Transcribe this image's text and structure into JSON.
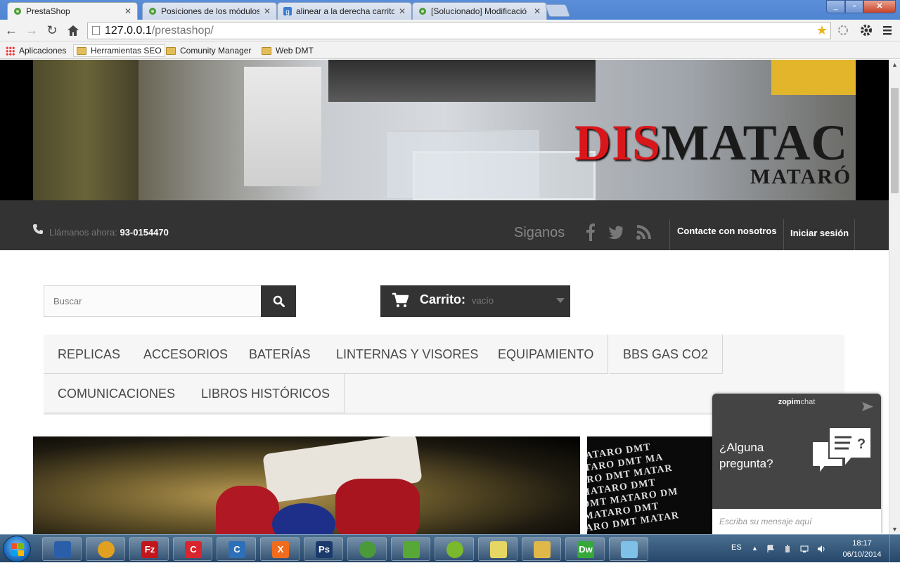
{
  "browser": {
    "tabs": [
      {
        "label": "PrestaShop",
        "active": true,
        "icon": "prestashop-icon"
      },
      {
        "label": "Posiciones de los módulos",
        "active": false,
        "icon": "prestashop-icon"
      },
      {
        "label": "alinear a la derecha carrito",
        "active": false,
        "icon": "google-icon"
      },
      {
        "label": "[Solucionado] Modificació",
        "active": false,
        "icon": "prestashop-icon"
      }
    ],
    "tab_close_glyph": "✕",
    "url_host": "127.0.0.1",
    "url_path": "/prestashop/",
    "bookmarks": [
      "Aplicaciones",
      "Herramientas SEO",
      "Comunity Manager",
      "Web DMT"
    ]
  },
  "header": {
    "brand_red": "DIS",
    "brand_dark": "MATAC",
    "brand_sub": "MATARÓ",
    "call_label": "Llámanos ahora:",
    "phone": "93-0154470",
    "follow_label": "Siganos",
    "social_icons": [
      "facebook-icon",
      "twitter-icon",
      "rss-icon"
    ],
    "contact_label": "Contacte con nosotros",
    "login_label": "Iniciar sesión"
  },
  "search": {
    "placeholder": "Buscar"
  },
  "cart": {
    "title": "Carrito:",
    "status": "vacío"
  },
  "menu": [
    "REPLICAS",
    "ACCESORIOS",
    "BATERÍAS",
    "LINTERNAS Y VISORES",
    "EQUIPAMIENTO",
    "BBS GAS CO2",
    "COMUNICACIONES",
    "LIBROS HISTÓRICOS"
  ],
  "slide_right_text": [
    "MATARO DMT",
    "ATARO DMT MA",
    "ARO DMT MATAR",
    "MATARO DMT",
    "DMT MATARO DM",
    "MATARO DMT",
    "ARO DMT MATAR"
  ],
  "chat": {
    "brand_bold": "zopim",
    "brand_light": "chat",
    "question": "¿Alguna pregunta?",
    "placeholder": "Escriba su mensaje aquí"
  },
  "taskbar": {
    "apps": [
      {
        "name": "thunderbird-icon",
        "color": "#2a5ea8",
        "glyph": ""
      },
      {
        "name": "chrome-icon",
        "color": "#e0a020",
        "glyph": ""
      },
      {
        "name": "filezilla-icon",
        "color": "#c3161c",
        "glyph": "Fz"
      },
      {
        "name": "ccleaner-red-icon",
        "color": "#d9262e",
        "glyph": "C"
      },
      {
        "name": "ccleaner-icon",
        "color": "#2d6fb8",
        "glyph": "C"
      },
      {
        "name": "xampp-icon",
        "color": "#f06c1c",
        "glyph": "X"
      },
      {
        "name": "photoshop-icon",
        "color": "#1b3a6b",
        "glyph": "Ps"
      },
      {
        "name": "greenshot-icon",
        "color": "#4a9a3a",
        "glyph": ""
      },
      {
        "name": "notepad-icon",
        "color": "#58a838",
        "glyph": ""
      },
      {
        "name": "spotify-icon",
        "color": "#7ab82e",
        "glyph": ""
      },
      {
        "name": "sticky-notes-icon",
        "color": "#e6d664",
        "glyph": ""
      },
      {
        "name": "explorer-icon",
        "color": "#e0b84a",
        "glyph": ""
      },
      {
        "name": "dreamweaver-icon",
        "color": "#35a83a",
        "glyph": "Dw"
      },
      {
        "name": "paint-icon",
        "color": "#7ec0e8",
        "glyph": ""
      }
    ],
    "lang": "ES",
    "time": "18:17",
    "date": "06/10/2014"
  }
}
